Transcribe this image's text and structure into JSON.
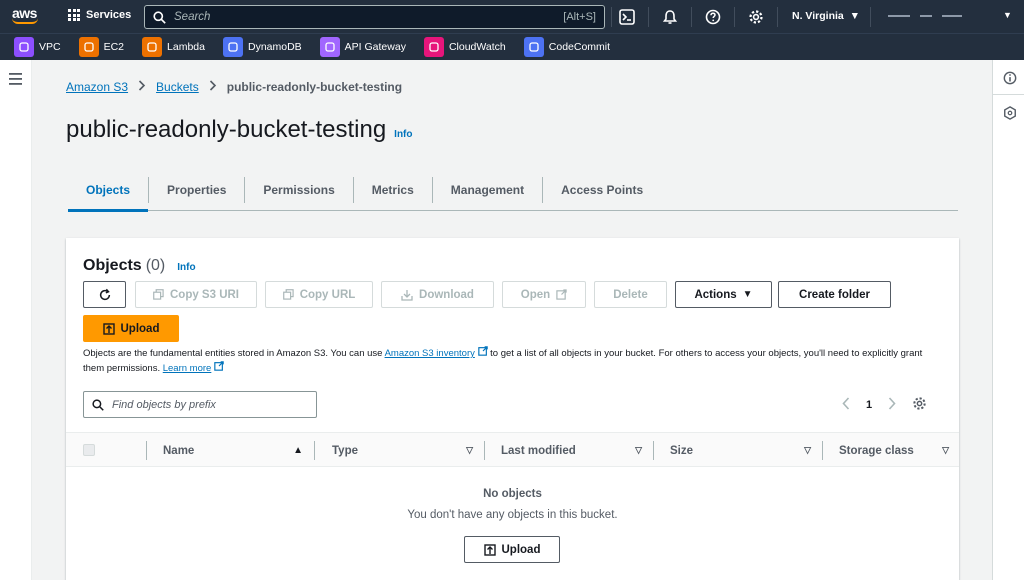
{
  "header": {
    "logo_text": "aws",
    "services_label": "Services",
    "search_placeholder": "Search",
    "search_shortcut": "[Alt+S]",
    "region_label": "N. Virginia"
  },
  "favorites": [
    {
      "label": "VPC",
      "color": "#8c4fff"
    },
    {
      "label": "EC2",
      "color": "#ed7100"
    },
    {
      "label": "Lambda",
      "color": "#ed7100"
    },
    {
      "label": "DynamoDB",
      "color": "#4d72f3"
    },
    {
      "label": "API Gateway",
      "color": "#a166ff"
    },
    {
      "label": "CloudWatch",
      "color": "#e7157b"
    },
    {
      "label": "CodeCommit",
      "color": "#4d72f3"
    }
  ],
  "breadcrumb": {
    "items": [
      "Amazon S3",
      "Buckets",
      "public-readonly-bucket-testing"
    ]
  },
  "page": {
    "title": "public-readonly-bucket-testing",
    "info_label": "Info"
  },
  "tabs": [
    "Objects",
    "Properties",
    "Permissions",
    "Metrics",
    "Management",
    "Access Points"
  ],
  "objects_panel": {
    "title": "Objects",
    "count": "(0)",
    "info_label": "Info",
    "buttons": {
      "copy_s3_uri": "Copy S3 URI",
      "copy_url": "Copy URL",
      "download": "Download",
      "open": "Open",
      "delete": "Delete",
      "actions": "Actions",
      "create_folder": "Create folder",
      "upload": "Upload"
    },
    "description": {
      "part1": "Objects are the fundamental entities stored in Amazon S3. You can use ",
      "link1": "Amazon S3 inventory",
      "part2": " to get a list of all objects in your bucket. For others to access your objects, you'll need to explicitly grant them permissions. ",
      "link2": "Learn more"
    },
    "filter_placeholder": "Find objects by prefix",
    "page_number": "1",
    "columns": [
      "Name",
      "Type",
      "Last modified",
      "Size",
      "Storage class"
    ],
    "empty_title": "No objects",
    "empty_message": "You don't have any objects in this bucket.",
    "empty_upload": "Upload"
  },
  "colors": {
    "nav_bg": "#232f3e",
    "accent": "#0073bb",
    "primary": "#ff9900"
  }
}
